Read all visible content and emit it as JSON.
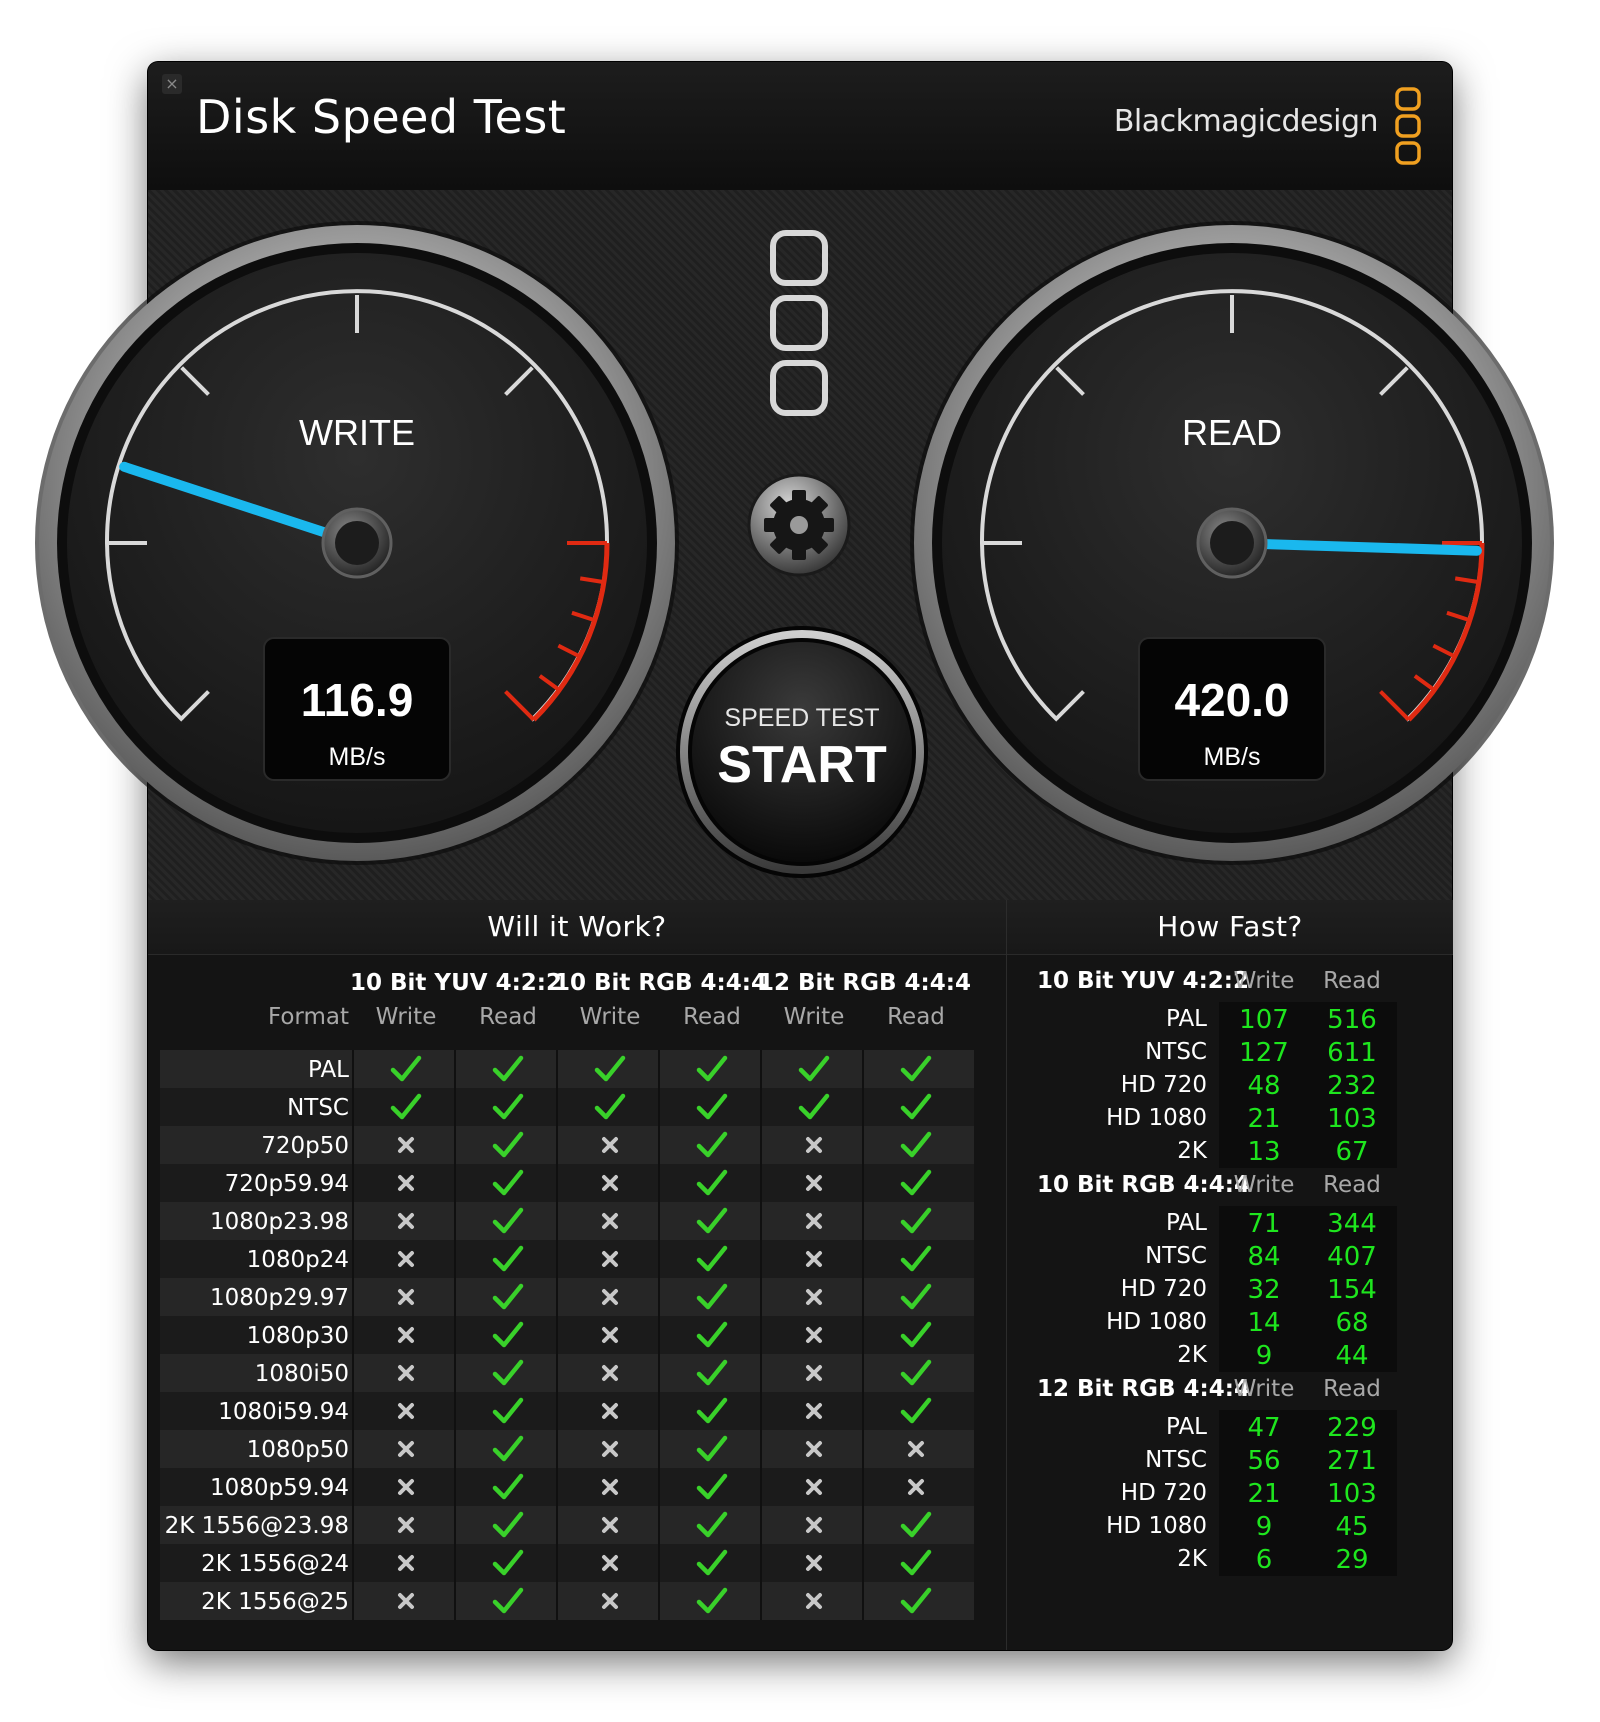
{
  "window": {
    "title": "Disk Speed Test",
    "brand": "Blackmagicdesign",
    "close_glyph": "×"
  },
  "gauges": {
    "write": {
      "label": "WRITE",
      "value": "116.9",
      "unit": "MB/s",
      "max_scale": 500
    },
    "read": {
      "label": "READ",
      "value": "420.0",
      "unit": "MB/s",
      "max_scale": 500
    },
    "needle_color": "#1ab8ee",
    "redline_color": "#e02a12"
  },
  "start_button": {
    "line1": "SPEED TEST",
    "line2": "START"
  },
  "settings_icon": "gear-icon",
  "will_it_work": {
    "title": "Will it Work?",
    "format_header": "Format",
    "groups": [
      {
        "name": "10 Bit YUV 4:2:2",
        "write": "Write",
        "read": "Read"
      },
      {
        "name": "10 Bit RGB 4:4:4",
        "write": "Write",
        "read": "Read"
      },
      {
        "name": "12 Bit RGB 4:4:4",
        "write": "Write",
        "read": "Read"
      }
    ],
    "rows": [
      {
        "format": "PAL",
        "results": [
          true,
          true,
          true,
          true,
          true,
          true
        ]
      },
      {
        "format": "NTSC",
        "results": [
          true,
          true,
          true,
          true,
          true,
          true
        ]
      },
      {
        "format": "720p50",
        "results": [
          false,
          true,
          false,
          true,
          false,
          true
        ]
      },
      {
        "format": "720p59.94",
        "results": [
          false,
          true,
          false,
          true,
          false,
          true
        ]
      },
      {
        "format": "1080p23.98",
        "results": [
          false,
          true,
          false,
          true,
          false,
          true
        ]
      },
      {
        "format": "1080p24",
        "results": [
          false,
          true,
          false,
          true,
          false,
          true
        ]
      },
      {
        "format": "1080p29.97",
        "results": [
          false,
          true,
          false,
          true,
          false,
          true
        ]
      },
      {
        "format": "1080p30",
        "results": [
          false,
          true,
          false,
          true,
          false,
          true
        ]
      },
      {
        "format": "1080i50",
        "results": [
          false,
          true,
          false,
          true,
          false,
          true
        ]
      },
      {
        "format": "1080i59.94",
        "results": [
          false,
          true,
          false,
          true,
          false,
          true
        ]
      },
      {
        "format": "1080p50",
        "results": [
          false,
          true,
          false,
          true,
          false,
          false
        ]
      },
      {
        "format": "1080p59.94",
        "results": [
          false,
          true,
          false,
          true,
          false,
          false
        ]
      },
      {
        "format": "2K 1556@23.98",
        "results": [
          false,
          true,
          false,
          true,
          false,
          true
        ]
      },
      {
        "format": "2K 1556@24",
        "results": [
          false,
          true,
          false,
          true,
          false,
          true
        ]
      },
      {
        "format": "2K 1556@25",
        "results": [
          false,
          true,
          false,
          true,
          false,
          true
        ]
      }
    ],
    "check_color": "#39d12a",
    "cross_color": "#c8c8c8"
  },
  "how_fast": {
    "title": "How Fast?",
    "groups": [
      {
        "name": "10 Bit YUV 4:2:2",
        "write_head": "Write",
        "read_head": "Read",
        "rows": [
          {
            "label": "PAL",
            "write": "107",
            "read": "516"
          },
          {
            "label": "NTSC",
            "write": "127",
            "read": "611"
          },
          {
            "label": "HD 720",
            "write": "48",
            "read": "232"
          },
          {
            "label": "HD 1080",
            "write": "21",
            "read": "103"
          },
          {
            "label": "2K",
            "write": "13",
            "read": "67"
          }
        ]
      },
      {
        "name": "10 Bit RGB 4:4:4",
        "write_head": "Write",
        "read_head": "Read",
        "rows": [
          {
            "label": "PAL",
            "write": "71",
            "read": "344"
          },
          {
            "label": "NTSC",
            "write": "84",
            "read": "407"
          },
          {
            "label": "HD 720",
            "write": "32",
            "read": "154"
          },
          {
            "label": "HD 1080",
            "write": "14",
            "read": "68"
          },
          {
            "label": "2K",
            "write": "9",
            "read": "44"
          }
        ]
      },
      {
        "name": "12 Bit RGB 4:4:4",
        "write_head": "Write",
        "read_head": "Read",
        "rows": [
          {
            "label": "PAL",
            "write": "47",
            "read": "229"
          },
          {
            "label": "NTSC",
            "write": "56",
            "read": "271"
          },
          {
            "label": "HD 720",
            "write": "21",
            "read": "103"
          },
          {
            "label": "HD 1080",
            "write": "9",
            "read": "45"
          },
          {
            "label": "2K",
            "write": "6",
            "read": "29"
          }
        ]
      }
    ],
    "value_color": "#1ee61e"
  }
}
